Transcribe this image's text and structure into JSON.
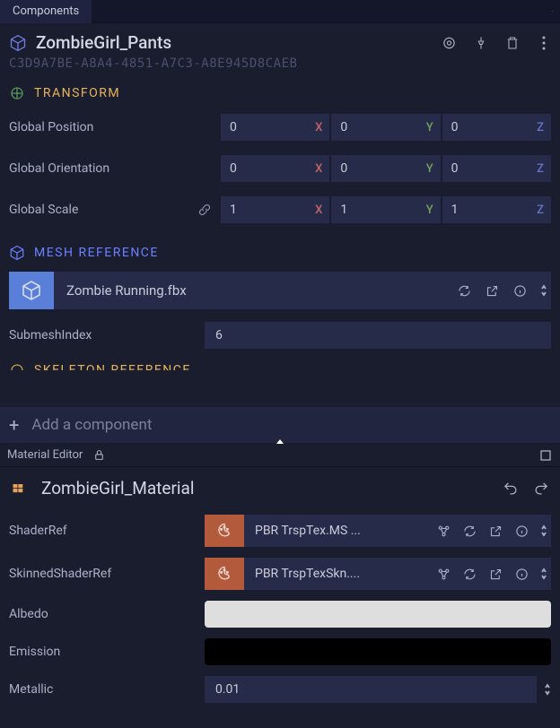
{
  "tab": {
    "label": "Components"
  },
  "header": {
    "name": "ZombieGirl_Pants",
    "guid": "C3D9A7BE-A8A4-4851-A7C3-A8E945D8CAEB"
  },
  "sections": {
    "transform": "TRANSFORM",
    "mesh": "MESH REFERENCE",
    "skeleton": "SKELETON REFERENCE"
  },
  "transform": {
    "position_label": "Global Position",
    "orientation_label": "Global Orientation",
    "scale_label": "Global Scale",
    "position": {
      "x": "0",
      "y": "0",
      "z": "0"
    },
    "orientation": {
      "x": "0",
      "y": "0",
      "z": "0"
    },
    "scale": {
      "x": "1",
      "y": "1",
      "z": "1"
    },
    "axis_x": "X",
    "axis_y": "Y",
    "axis_z": "Z"
  },
  "mesh": {
    "asset": "Zombie Running.fbx",
    "submesh_label": "SubmeshIndex",
    "submesh_value": "6"
  },
  "add_component_label": "Add a component",
  "material_panel": {
    "tab": "Material Editor",
    "name": "ZombieGirl_Material",
    "shader_ref_label": "ShaderRef",
    "shader_ref_value": "PBR TrspTex.MS ...",
    "skinned_shader_ref_label": "SkinnedShaderRef",
    "skinned_shader_ref_value": "PBR TrspTexSkn....",
    "albedo_label": "Albedo",
    "emission_label": "Emission",
    "metallic_label": "Metallic",
    "metallic_value": "0.01",
    "colors": {
      "albedo": "#dedede",
      "emission": "#000000"
    }
  }
}
